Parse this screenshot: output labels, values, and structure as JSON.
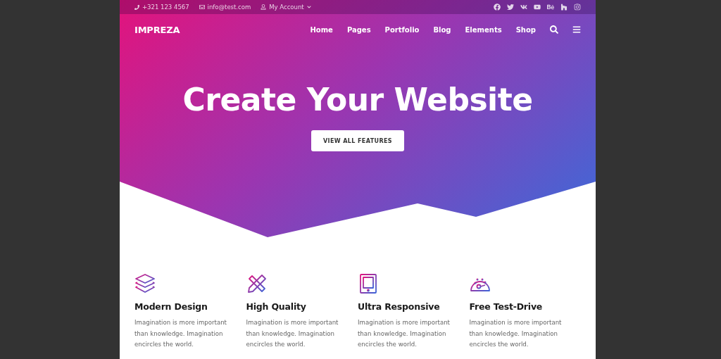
{
  "top_bar": {
    "phone": "+321 123 4567",
    "email": "info@test.com",
    "account": "My Account"
  },
  "header": {
    "logo": "IMPREZA",
    "nav": [
      {
        "label": "Home"
      },
      {
        "label": "Pages"
      },
      {
        "label": "Portfolio"
      },
      {
        "label": "Blog"
      },
      {
        "label": "Elements"
      },
      {
        "label": "Shop"
      }
    ]
  },
  "hero": {
    "title": "Create Your Website",
    "button": "VIEW ALL FEATURES"
  },
  "features": [
    {
      "title": "Modern Design",
      "text": "Imagination is more important than knowledge. Imagination encircles the world."
    },
    {
      "title": "High Quality",
      "text": "Imagination is more important than knowledge. Imagination encircles the world."
    },
    {
      "title": "Ultra Responsive",
      "text": "Imagination is more important than knowledge. Imagination encircles the world."
    },
    {
      "title": "Free Test-Drive",
      "text": "Imagination is more important than knowledge. Imagination encircles the world."
    }
  ]
}
